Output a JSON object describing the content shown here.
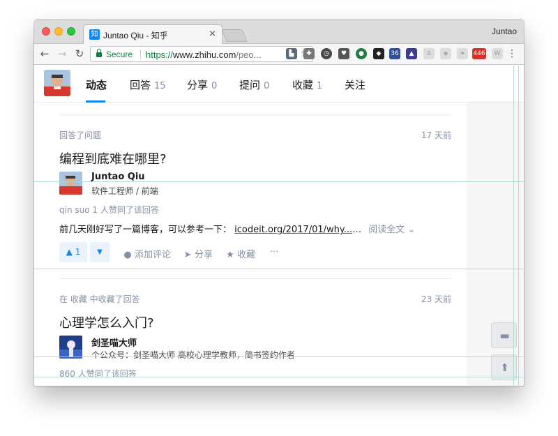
{
  "browser": {
    "tab_favicon": "知",
    "tab_title": "Juntao Qiu - 知乎",
    "tab_close": "×",
    "profile_name": "Juntao",
    "secure_label": "Secure",
    "url_scheme": "https://",
    "url_host": "www.zhihu.com",
    "url_path": "/peo...",
    "icons": [
      "back-icon",
      "forward-icon",
      "reload-icon",
      "lock-icon",
      "star-icon",
      "menu-icon"
    ],
    "extension_badges": {
      "calendar": "36",
      "gmail": "446"
    }
  },
  "profile_nav": {
    "tabs": [
      {
        "label": "动态",
        "count": ""
      },
      {
        "label": "回答",
        "count": "15"
      },
      {
        "label": "分享",
        "count": "0"
      },
      {
        "label": "提问",
        "count": "0"
      },
      {
        "label": "收藏",
        "count": "1"
      },
      {
        "label": "关注",
        "count": ""
      }
    ],
    "active_tab": "动态",
    "accent_color": "#0f88eb"
  },
  "feed": [
    {
      "meta": "回答了问题",
      "time": "17 天前",
      "question": "编程到底难在哪里?",
      "author_name": "Juntao Qiu",
      "author_bio": "软件工程师 / 前端",
      "votes_text": "qin suo 1 人赞同了该回答",
      "excerpt_text": "前几天刚好写了一篇博客，可以参考一下：",
      "excerpt_link": "icodeit.org/2017/01/why...",
      "excerpt_ellipsis": "…",
      "read_more": "阅读全文",
      "upvote_label": "▲ 1",
      "downvote_label": "▼",
      "comment_label": "添加评论",
      "share_label": "分享",
      "collect_label": "收藏",
      "more_label": "···"
    },
    {
      "meta": "在 收藏 中收藏了回答",
      "time": "23 天前",
      "question": "心理学怎么入门?",
      "author_name": "剑圣喵大师",
      "author_bio": "个公众号：剑圣喵大师 高校心理学教师，简书签约作者",
      "votes_text": "860 人赞同了该回答"
    }
  ]
}
